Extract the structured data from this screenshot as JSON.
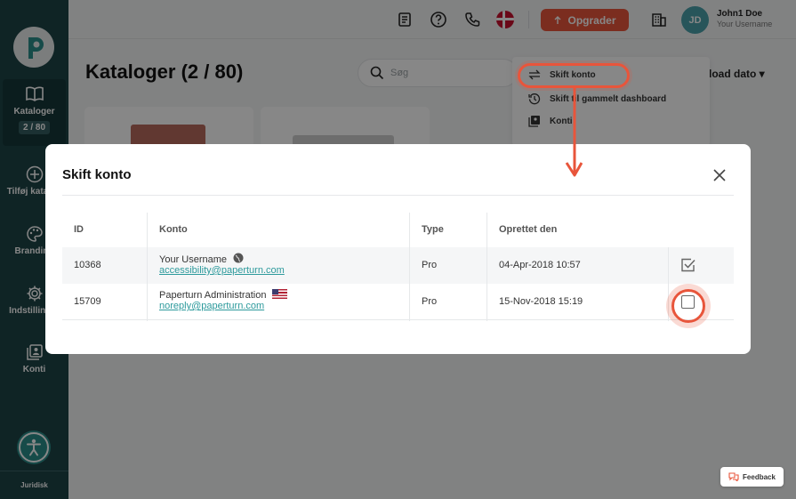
{
  "sidebar": {
    "items": [
      {
        "label": "Kataloger",
        "badge": "2 / 80",
        "icon": "book-icon"
      },
      {
        "label": "Tilføj katalog",
        "icon": "plus-circle-icon"
      },
      {
        "label": "Branding",
        "icon": "palette-icon"
      },
      {
        "label": "Indstillinger",
        "icon": "gear-icon"
      },
      {
        "label": "Konti",
        "icon": "accounts-icon"
      }
    ],
    "footer_label": "Juridisk",
    "accessibility_icon": "accessibility-icon"
  },
  "topbar": {
    "upgrade_label": "Opgrader",
    "user_name": "John1 Doe",
    "user_sub": "Your Username",
    "avatar_initials": "JD"
  },
  "page": {
    "title": "Kataloger (2 / 80)",
    "search_placeholder": "Søg",
    "sort_label": "load dato"
  },
  "dropdown": {
    "items": [
      {
        "label": "Skift konto",
        "icon": "swap-icon"
      },
      {
        "label": "Skift til gammelt dashboard",
        "icon": "history-icon"
      },
      {
        "label": "Konti",
        "icon": "accounts-icon"
      }
    ]
  },
  "modal": {
    "title": "Skift konto",
    "columns": [
      "ID",
      "Konto",
      "Type",
      "Oprettet den"
    ],
    "rows": [
      {
        "id": "10368",
        "name": "Your Username",
        "email": "accessibility@paperturn.com",
        "type": "Pro",
        "created": "04-Apr-2018 10:57",
        "checked": true
      },
      {
        "id": "15709",
        "name": "Paperturn Administration",
        "email": "noreply@paperturn.com",
        "type": "Pro",
        "created": "15-Nov-2018 15:19",
        "checked": false
      }
    ]
  },
  "feedback_label": "Feedback",
  "colors": {
    "sidebar": "#1e4447",
    "accent": "#e8553b",
    "link": "#2d9a9c",
    "avatar": "#4aa1aa"
  }
}
